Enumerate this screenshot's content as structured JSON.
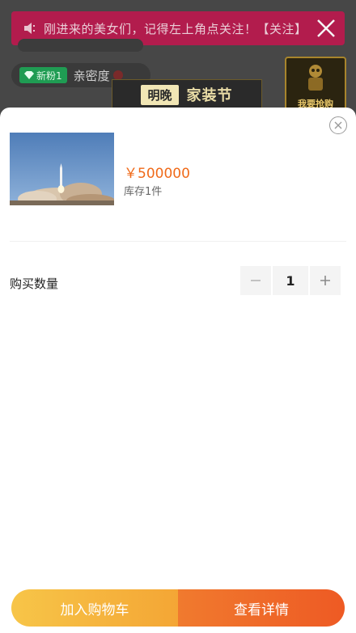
{
  "background": {
    "banner": {
      "text": "刚进来的美女们，记得左上角点关注！【关注】"
    },
    "fan_badge": {
      "label": "新粉1"
    },
    "intimacy_label": "亲密度",
    "promo": {
      "tag": "明晚",
      "title": "家装节"
    },
    "gift": {
      "label": "我要抢购"
    }
  },
  "sheet": {
    "product": {
      "price": "￥500000",
      "stock": "库存1件"
    },
    "quantity": {
      "label": "购买数量",
      "value": "1"
    },
    "buttons": {
      "add_to_cart": "加入购物车",
      "view_details": "查看详情"
    }
  },
  "colors": {
    "price": "#f06a19",
    "cart_gradient": [
      "#f7c548",
      "#f4a635"
    ],
    "details_gradient": [
      "#f07a2e",
      "#ee5a24"
    ],
    "banner": "#b81a4e"
  }
}
